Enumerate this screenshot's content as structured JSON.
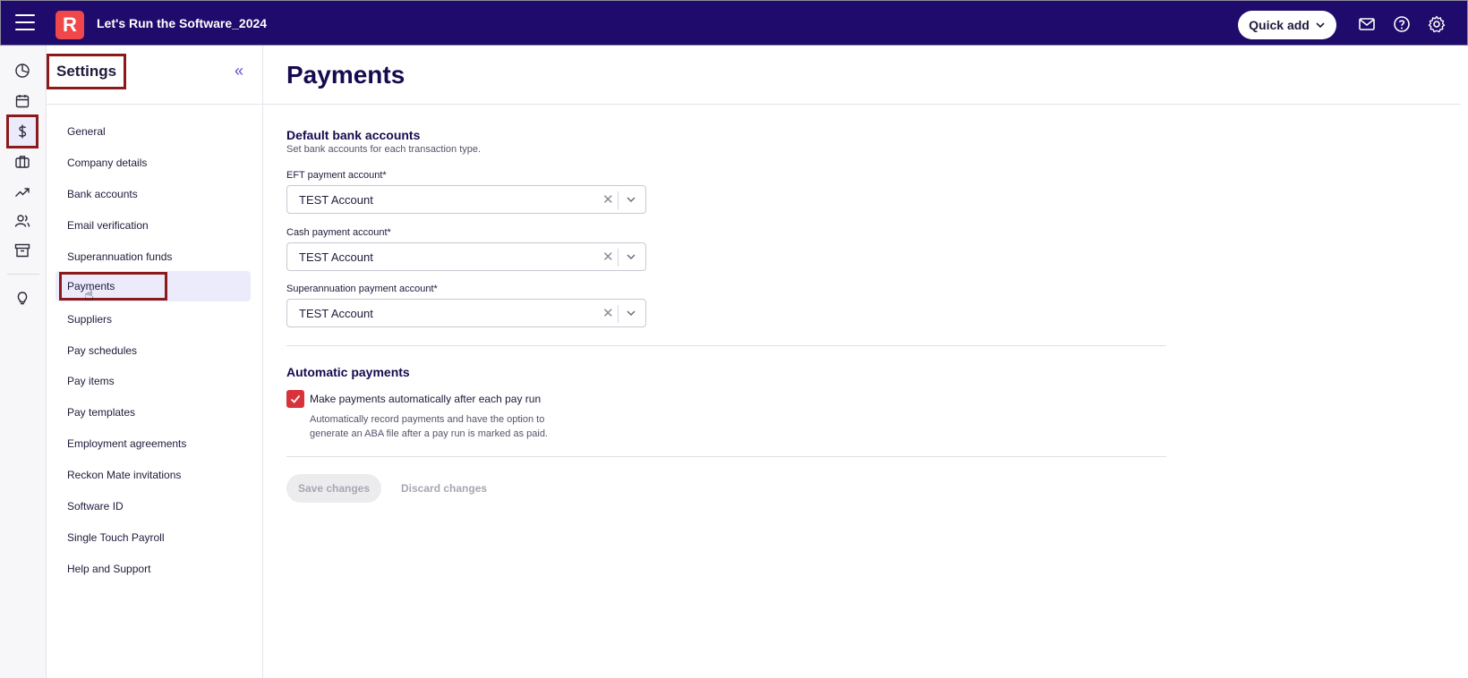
{
  "app": {
    "title": "Let's Run the Software_2024",
    "logo_letter": "R"
  },
  "topbar": {
    "quick_add_label": "Quick add",
    "icons": [
      "mail-icon",
      "help-icon",
      "settings-gear-icon"
    ]
  },
  "rail": {
    "icons": [
      "dashboard-icon",
      "calendar-icon",
      "payroll-dollar-icon",
      "briefcase-icon",
      "reports-trend-icon",
      "people-icon",
      "archive-icon",
      "lightbulb-icon"
    ],
    "active": "payroll-dollar-icon"
  },
  "sidebar": {
    "title": "Settings",
    "collapse_glyph": "«",
    "items": [
      {
        "label": "General"
      },
      {
        "label": "Company details"
      },
      {
        "label": "Bank accounts"
      },
      {
        "label": "Email verification"
      },
      {
        "label": "Superannuation funds"
      },
      {
        "label": "Payments"
      },
      {
        "label": "Suppliers"
      },
      {
        "label": "Pay schedules"
      },
      {
        "label": "Pay items"
      },
      {
        "label": "Pay templates"
      },
      {
        "label": "Employment agreements"
      },
      {
        "label": "Reckon Mate invitations"
      },
      {
        "label": "Software ID"
      },
      {
        "label": "Single Touch Payroll"
      },
      {
        "label": "Help and Support"
      }
    ],
    "active_item": "Payments"
  },
  "main": {
    "title": "Payments",
    "bank": {
      "heading": "Default bank accounts",
      "subheading": "Set bank accounts for each transaction type.",
      "eft_label": "EFT payment account*",
      "eft_value": "TEST Account",
      "cash_label": "Cash payment account*",
      "cash_value": "TEST Account",
      "super_label": "Superannuation payment account*",
      "super_value": "TEST Account"
    },
    "auto": {
      "heading": "Automatic payments",
      "checkbox_label": "Make payments automatically after each pay run",
      "checked": true,
      "help_line1": "Automatically record payments and have the option to",
      "help_line2": "generate an ABA file after a pay run is marked as paid."
    },
    "actions": {
      "save_label": "Save changes",
      "discard_label": "Discard changes"
    }
  },
  "colors": {
    "topbar": "#1e0b6b",
    "brand": "#f0474a",
    "checkbox": "#d8333b",
    "highlight": "#8b1a1a"
  }
}
